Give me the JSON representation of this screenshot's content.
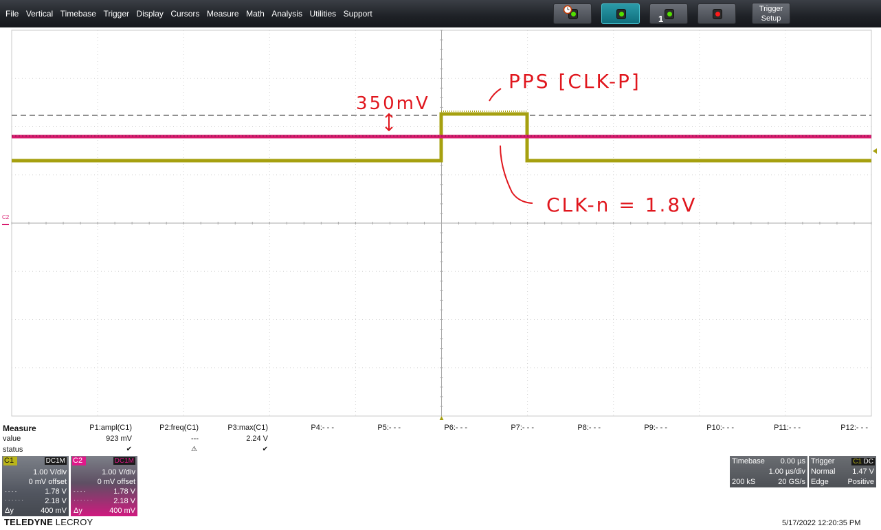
{
  "menu": {
    "items": [
      "File",
      "Vertical",
      "Timebase",
      "Trigger",
      "Display",
      "Cursors",
      "Measure",
      "Math",
      "Analysis",
      "Utilities",
      "Support"
    ]
  },
  "toolbar": {
    "trigger_setup_label_1": "Trigger",
    "trigger_setup_label_2": "Setup",
    "single_badge": "1",
    "colors": {
      "green_lamp": "#53e000",
      "red_lamp": "#ff1a1a",
      "active_button": "#1a8a98"
    }
  },
  "annotations": {
    "amplitude": "350mV",
    "signal_name": "PPS [CLK-P]",
    "clk_n": "CLK-n = 1.8V"
  },
  "channel_marker": "C2",
  "traces": {
    "c1_color": "#a6a00f",
    "c2_color": "#d81b6e"
  },
  "measure": {
    "title": "Measure",
    "row_value": "value",
    "row_status": "status",
    "params": [
      {
        "name": "P1:ampl(C1)",
        "value": "923 mV",
        "status": "✔"
      },
      {
        "name": "P2:freq(C1)",
        "value": "---",
        "status": "⚠"
      },
      {
        "name": "P3:max(C1)",
        "value": "2.24 V",
        "status": "✔"
      },
      {
        "name": "P4:- - -",
        "value": "",
        "status": ""
      },
      {
        "name": "P5:- - -",
        "value": "",
        "status": ""
      },
      {
        "name": "P6:- - -",
        "value": "",
        "status": ""
      },
      {
        "name": "P7:- - -",
        "value": "",
        "status": ""
      },
      {
        "name": "P8:- - -",
        "value": "",
        "status": ""
      },
      {
        "name": "P9:- - -",
        "value": "",
        "status": ""
      },
      {
        "name": "P10:- - -",
        "value": "",
        "status": ""
      },
      {
        "name": "P11:- - -",
        "value": "",
        "status": ""
      },
      {
        "name": "P12:- - -",
        "value": "",
        "status": ""
      }
    ]
  },
  "channels": [
    {
      "label": "C1",
      "coupling": "DC1M",
      "vdiv": "1.00 V/div",
      "offset": "0 mV offset",
      "c1_sym": "- - - -",
      "cursor1": "1.78 V",
      "c2_sym": "· · · · · ·",
      "cursor2": "2.18 V",
      "dy_label": "Δy",
      "dy": "400 mV",
      "color": "#b9b418"
    },
    {
      "label": "C2",
      "coupling": "DC1M",
      "vdiv": "1.00 V/div",
      "offset": "0 mV offset",
      "c1_sym": "- - - -",
      "cursor1": "1.78 V",
      "c2_sym": "· · · · · ·",
      "cursor2": "2.18 V",
      "dy_label": "Δy",
      "dy": "400 mV",
      "color": "#e0198a"
    }
  ],
  "timebase": {
    "label": "Timebase",
    "delay": "0.00 µs",
    "per_div": "1.00 µs/div",
    "samples": "200 kS",
    "rate": "20 GS/s"
  },
  "trigger": {
    "label": "Trigger",
    "source": "C1",
    "coupling": "DC",
    "mode": "Normal",
    "level": "1.47 V",
    "type": "Edge",
    "slope": "Positive"
  },
  "brand": {
    "bold": "TELEDYNE",
    "normal": "LECROY"
  },
  "datetime": "5/17/2022 12:20:35 PM"
}
